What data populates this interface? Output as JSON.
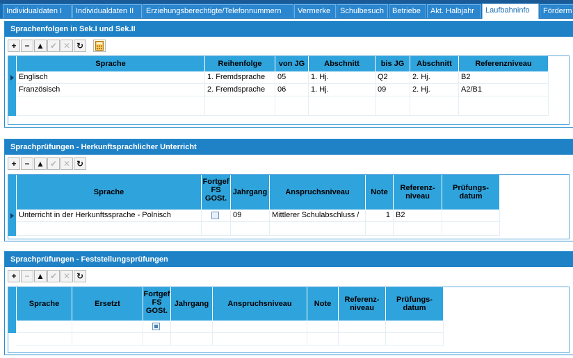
{
  "tabs": [
    {
      "label": "Individualdaten I",
      "active": false
    },
    {
      "label": "Individualdaten II",
      "active": false
    },
    {
      "label": "Erziehungsberechtigte/Telefonnummern",
      "active": false
    },
    {
      "label": "Vermerke",
      "active": false
    },
    {
      "label": "Schulbesuch",
      "active": false
    },
    {
      "label": "Betriebe",
      "active": false
    },
    {
      "label": "Akt. Halbjahr",
      "active": false
    },
    {
      "label": "Laufbahninfo",
      "active": true
    },
    {
      "label": "Förderm",
      "active": false
    }
  ],
  "sprachenfolgen": {
    "title": "Sprachenfolgen in Sek.I und Sek.II",
    "toolbar": [
      "add-icon",
      "remove-icon",
      "move-up-icon",
      "confirm-icon",
      "cancel-icon",
      "refresh-icon",
      "calculator-icon"
    ],
    "columns": [
      "Sprache",
      "Reihenfolge",
      "von JG",
      "Abschnitt",
      "bis JG",
      "Abschnitt",
      "Referenzniveau"
    ],
    "rows": [
      [
        "Englisch",
        "1. Fremdsprache",
        "05",
        "1. Hj.",
        "Q2",
        "2. Hj.",
        "B2"
      ],
      [
        "Französisch",
        "2. Fremdsprache",
        "06",
        "1. Hj.",
        "09",
        "2. Hj.",
        "A2/B1"
      ]
    ]
  },
  "herkunft": {
    "title": "Sprachprüfungen - Herkunftsprachlicher Unterricht",
    "toolbar": [
      "add-icon",
      "remove-icon",
      "move-up-icon",
      "confirm-icon",
      "cancel-icon",
      "refresh-icon"
    ],
    "columns": [
      "Sprache",
      "Fortgef FS GOSt.",
      "Jahrgang",
      "Anspruchsniveau",
      "Note",
      "Referenz-niveau",
      "Prüfungs-datum"
    ],
    "rows": [
      [
        "Unterricht in der Herkunftssprache - Polnisch",
        "",
        "09",
        "Mittlerer Schulabschluss /",
        "1",
        "B2",
        ""
      ]
    ]
  },
  "feststellung": {
    "title": "Sprachprüfungen - Feststellungsprüfungen",
    "toolbar": [
      "add-icon",
      "remove-icon",
      "move-up-icon",
      "confirm-icon",
      "cancel-icon",
      "refresh-icon"
    ],
    "columns": [
      "Sprache",
      "Ersetzt",
      "Fortgef FS GOSt.",
      "Jahrgang",
      "Anspruchsniveau",
      "Note",
      "Referenz-niveau",
      "Prüfungs-datum"
    ],
    "rows": []
  },
  "colors": {
    "header": "#2fa3dc",
    "tabbar": "#1a70b8",
    "section_title": "#1f82c6"
  }
}
